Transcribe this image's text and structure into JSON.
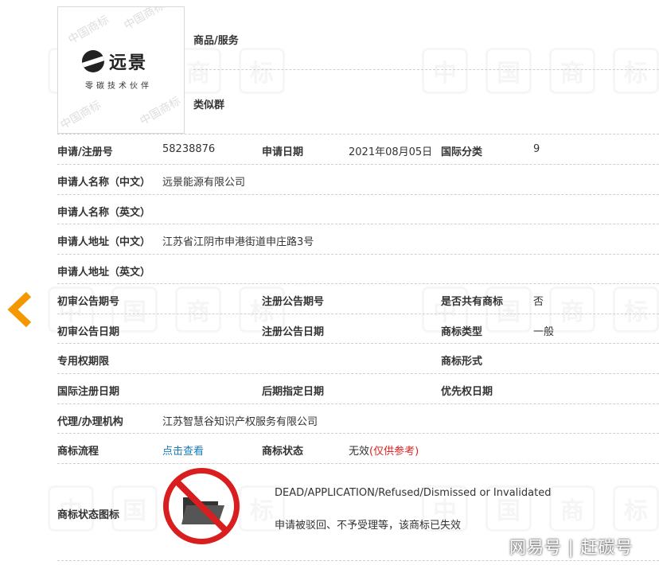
{
  "logo": {
    "brand_name": "远景",
    "tagline": "零碳技术伙伴",
    "watermark_text": "中国商标"
  },
  "goods": {
    "goods_label": "商品/服务",
    "group_label": "类似群"
  },
  "details": {
    "app_no_label": "申请/注册号",
    "app_no": "58238876",
    "app_date_label": "申请日期",
    "app_date": "2021年08月05日",
    "intl_class_label": "国际分类",
    "intl_class": "9",
    "applicant_cn_label": "申请人名称（中文）",
    "applicant_cn": "远景能源有限公司",
    "applicant_en_label": "申请人名称（英文）",
    "address_cn_label": "申请人地址（中文）",
    "address_cn": "江苏省江阴市申港街道申庄路3号",
    "address_en_label": "申请人地址（英文）",
    "prelim_pub_no_label": "初审公告期号",
    "reg_pub_no_label": "注册公告期号",
    "shared_label": "是否共有商标",
    "shared": "否",
    "prelim_pub_date_label": "初审公告日期",
    "reg_pub_date_label": "注册公告日期",
    "tm_type_label": "商标类型",
    "tm_type": "一般",
    "exclusive_period_label": "专用权期限",
    "tm_form_label": "商标形式",
    "intl_reg_date_label": "国际注册日期",
    "later_designation_label": "后期指定日期",
    "priority_date_label": "优先权日期",
    "agent_label": "代理/办理机构",
    "agent": "江苏智慧谷知识产权服务有限公司",
    "process_label": "商标流程",
    "process_link": "点击查看",
    "status_label": "商标状态",
    "status": "无效",
    "status_note": "(仅供参考)",
    "status_icon_label": "商标状态图标",
    "status_en": "DEAD/APPLICATION/Refused/Dismissed or Invalidated",
    "status_cn": "申请被驳回、不予受理等，该商标已失效"
  },
  "watermark": {
    "glyphs": [
      "中",
      "国",
      "商",
      "标"
    ]
  },
  "footer": {
    "brand": "网易号 | 赶碳号"
  },
  "colors": {
    "accent_orange": "#f39800",
    "link_blue": "#1a7bb9",
    "status_red": "#e02020",
    "forbidden_red": "#d81e1e"
  },
  "icons": {
    "back": "chevron-left-icon",
    "status": "no-entry-folder-icon"
  }
}
